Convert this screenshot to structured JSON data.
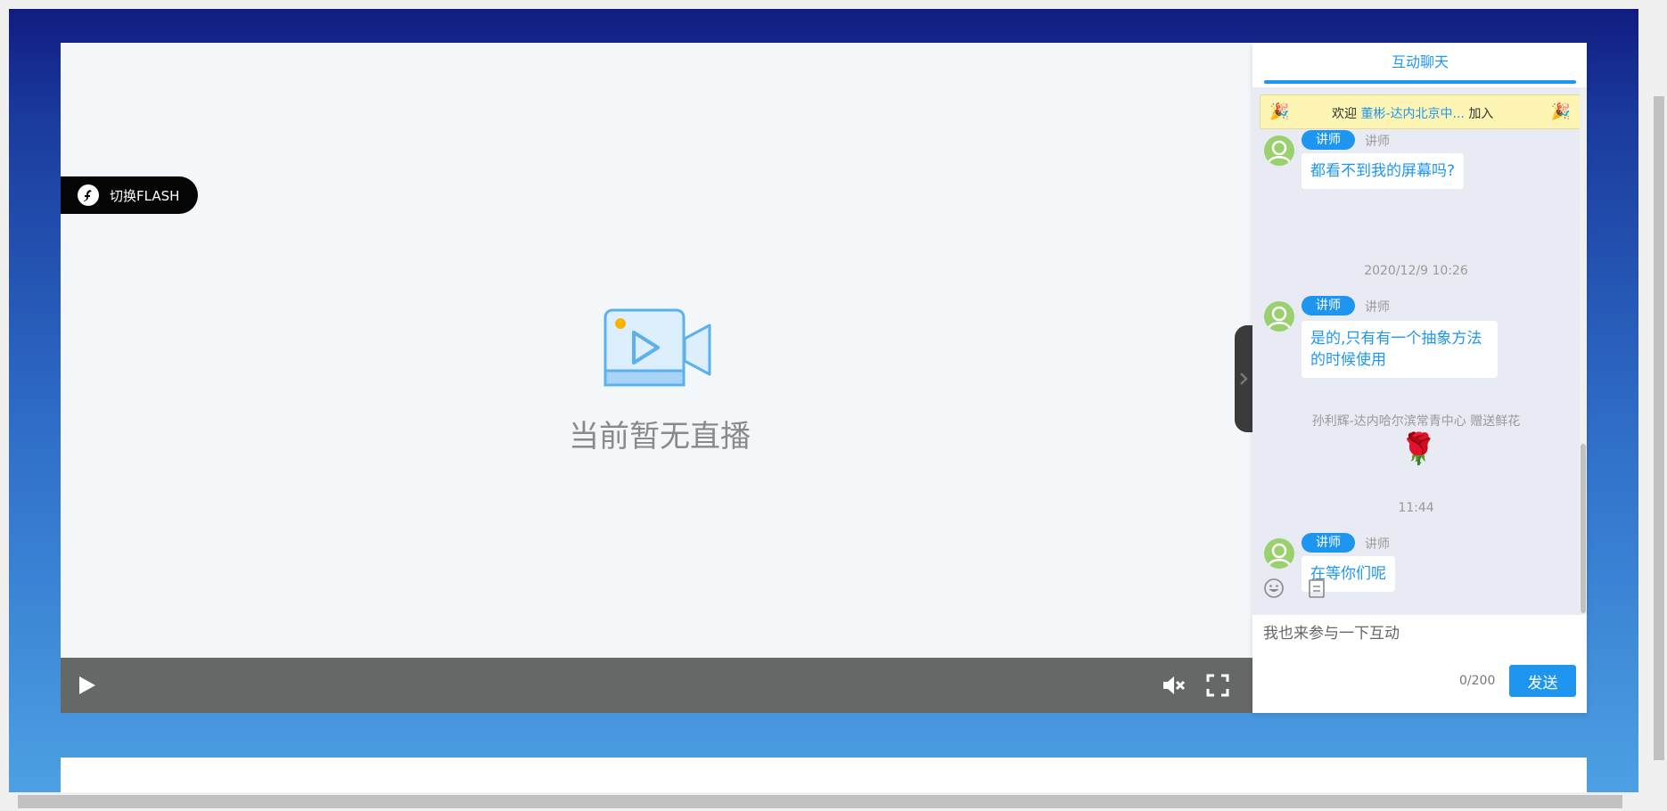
{
  "player": {
    "flash_button_label": "切换FLASH",
    "no_live_text": "当前暂无直播"
  },
  "chat": {
    "tab_label": "互动聊天",
    "welcome": {
      "prefix": "欢迎",
      "name": "董彬-达内北京中...",
      "suffix": "加入"
    },
    "messages": [
      {
        "role_badge": "讲师",
        "role_name": "讲师",
        "text": "都看不到我的屏幕吗?"
      },
      {
        "role_badge": "讲师",
        "role_name": "讲师",
        "text": "是的,只有有一个抽象方法的时候使用"
      },
      {
        "role_badge": "讲师",
        "role_name": "讲师",
        "text": "在等你们呢"
      }
    ],
    "times": [
      "2020/12/9 10:26",
      "11:44"
    ],
    "gift": {
      "text": "孙利辉-达内哈尔滨常青中心 赠送鲜花",
      "icon": "rose-icon"
    },
    "input_placeholder": "我也来参与一下互动",
    "char_count": "0/200",
    "send_label": "发送"
  },
  "colors": {
    "accent": "#1e96f0",
    "control_bar": "#666767",
    "welcome_bg": "#fcf5b4"
  }
}
